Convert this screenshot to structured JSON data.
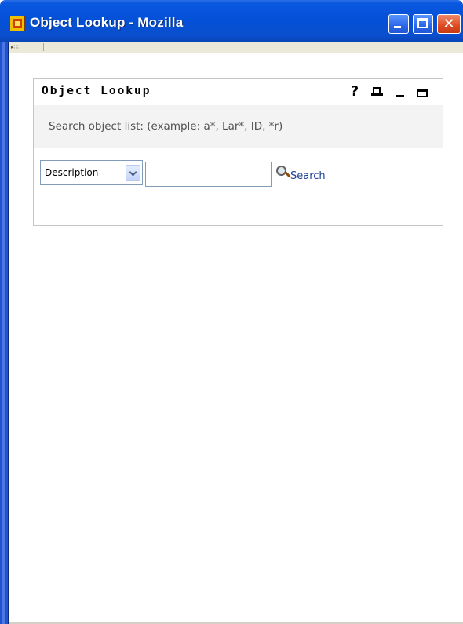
{
  "window": {
    "title": "Object Lookup - Mozilla",
    "icon": "mozilla-app-icon"
  },
  "titlebar_buttons": {
    "minimize": "minimize-icon",
    "maximize": "maximize-icon",
    "close": "close-icon",
    "close_glyph": "✕"
  },
  "portlet": {
    "title": "Object Lookup",
    "help_glyph": "?",
    "icons": [
      "help-icon",
      "print-icon",
      "minimize-icon",
      "maximize-icon"
    ],
    "description": "Search object list: (example: a*, Lar*, ID, *r)"
  },
  "search": {
    "field_selected": "Description",
    "query_value": "",
    "button_label": "Search",
    "button_icon": "magnifier-icon"
  },
  "colors": {
    "titlebar_blue": "#0450d6",
    "link_blue": "#1c3f94",
    "portlet_description_bg": "#f3f3f3"
  }
}
